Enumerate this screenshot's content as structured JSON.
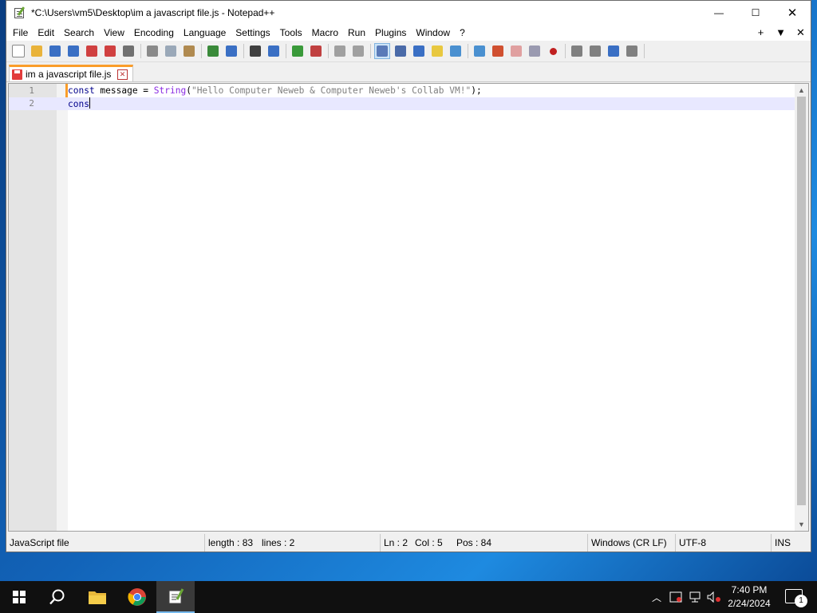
{
  "window": {
    "title": "*C:\\Users\\vm5\\Desktop\\im a javascript file.js - Notepad++",
    "minimize": "—",
    "maximize": "☐",
    "close": "✕"
  },
  "menu": {
    "items": [
      "File",
      "Edit",
      "Search",
      "View",
      "Encoding",
      "Language",
      "Settings",
      "Tools",
      "Macro",
      "Run",
      "Plugins",
      "Window",
      "?"
    ],
    "right": [
      "+",
      "▼",
      "✕"
    ]
  },
  "toolbar": {
    "icons": [
      "new-file-icon",
      "open-file-icon",
      "save-icon",
      "save-all-icon",
      "close-icon",
      "close-all-icon",
      "print-icon",
      "cut-icon",
      "copy-icon",
      "paste-icon",
      "undo-icon",
      "redo-icon",
      "find-icon",
      "replace-icon",
      "zoom-in-icon",
      "zoom-out-icon",
      "sync-vertical-icon",
      "sync-horizontal-icon",
      "word-wrap-icon",
      "show-all-chars-icon",
      "indent-guide-icon",
      "udl-icon",
      "doc-map-icon",
      "doc-list-icon",
      "function-list-icon",
      "folder-workspace-icon",
      "monitoring-icon",
      "record-macro-icon",
      "stop-macro-icon",
      "play-macro-icon",
      "run-macro-multiple-icon",
      "save-macro-icon"
    ],
    "colors": [
      "#ffffff",
      "#e9b33a",
      "#3a6fc4",
      "#3a6fc4",
      "#d04040",
      "#d04040",
      "#707070",
      "#8a8a8a",
      "#9aa8b8",
      "#b08a50",
      "#3a8a3a",
      "#3a6fc4",
      "#404040",
      "#3a6fc4",
      "#3a9a3a",
      "#c04040",
      "#a0a0a0",
      "#a0a0a0",
      "#5a7ab8",
      "#4a6aa8",
      "#3a6fc4",
      "#e8c840",
      "#4a90d0",
      "#4a90d0",
      "#d05030",
      "#e0a0a0",
      "#9a9ab0",
      "#c02020",
      "#808080",
      "#808080",
      "#3a6fc4",
      "#808080"
    ]
  },
  "tab": {
    "label": "im a javascript file.js",
    "close": "✕"
  },
  "editor": {
    "lines": [
      {
        "number": "1",
        "tokens": [
          {
            "t": "kw",
            "v": "const"
          },
          {
            "t": "op",
            "v": " message = "
          },
          {
            "t": "fn",
            "v": "String"
          },
          {
            "t": "op",
            "v": "("
          },
          {
            "t": "str",
            "v": "\"Hello Computer Neweb & Computer Neweb's Collab VM!\""
          },
          {
            "t": "op",
            "v": ");"
          }
        ]
      },
      {
        "number": "2",
        "tokens": [
          {
            "t": "kw",
            "v": "cons"
          }
        ]
      }
    ]
  },
  "status": {
    "file_type": "JavaScript file",
    "length": "length : 83",
    "lines": "lines : 2",
    "ln": "Ln : 2",
    "col": "Col : 5",
    "pos": "Pos : 84",
    "eol": "Windows (CR LF)",
    "encoding": "UTF-8",
    "mode": "INS"
  },
  "taskbar": {
    "clock_time": "7:40 PM",
    "clock_date": "2/24/2024",
    "notification_count": "1",
    "tray_chevron": "︿"
  }
}
